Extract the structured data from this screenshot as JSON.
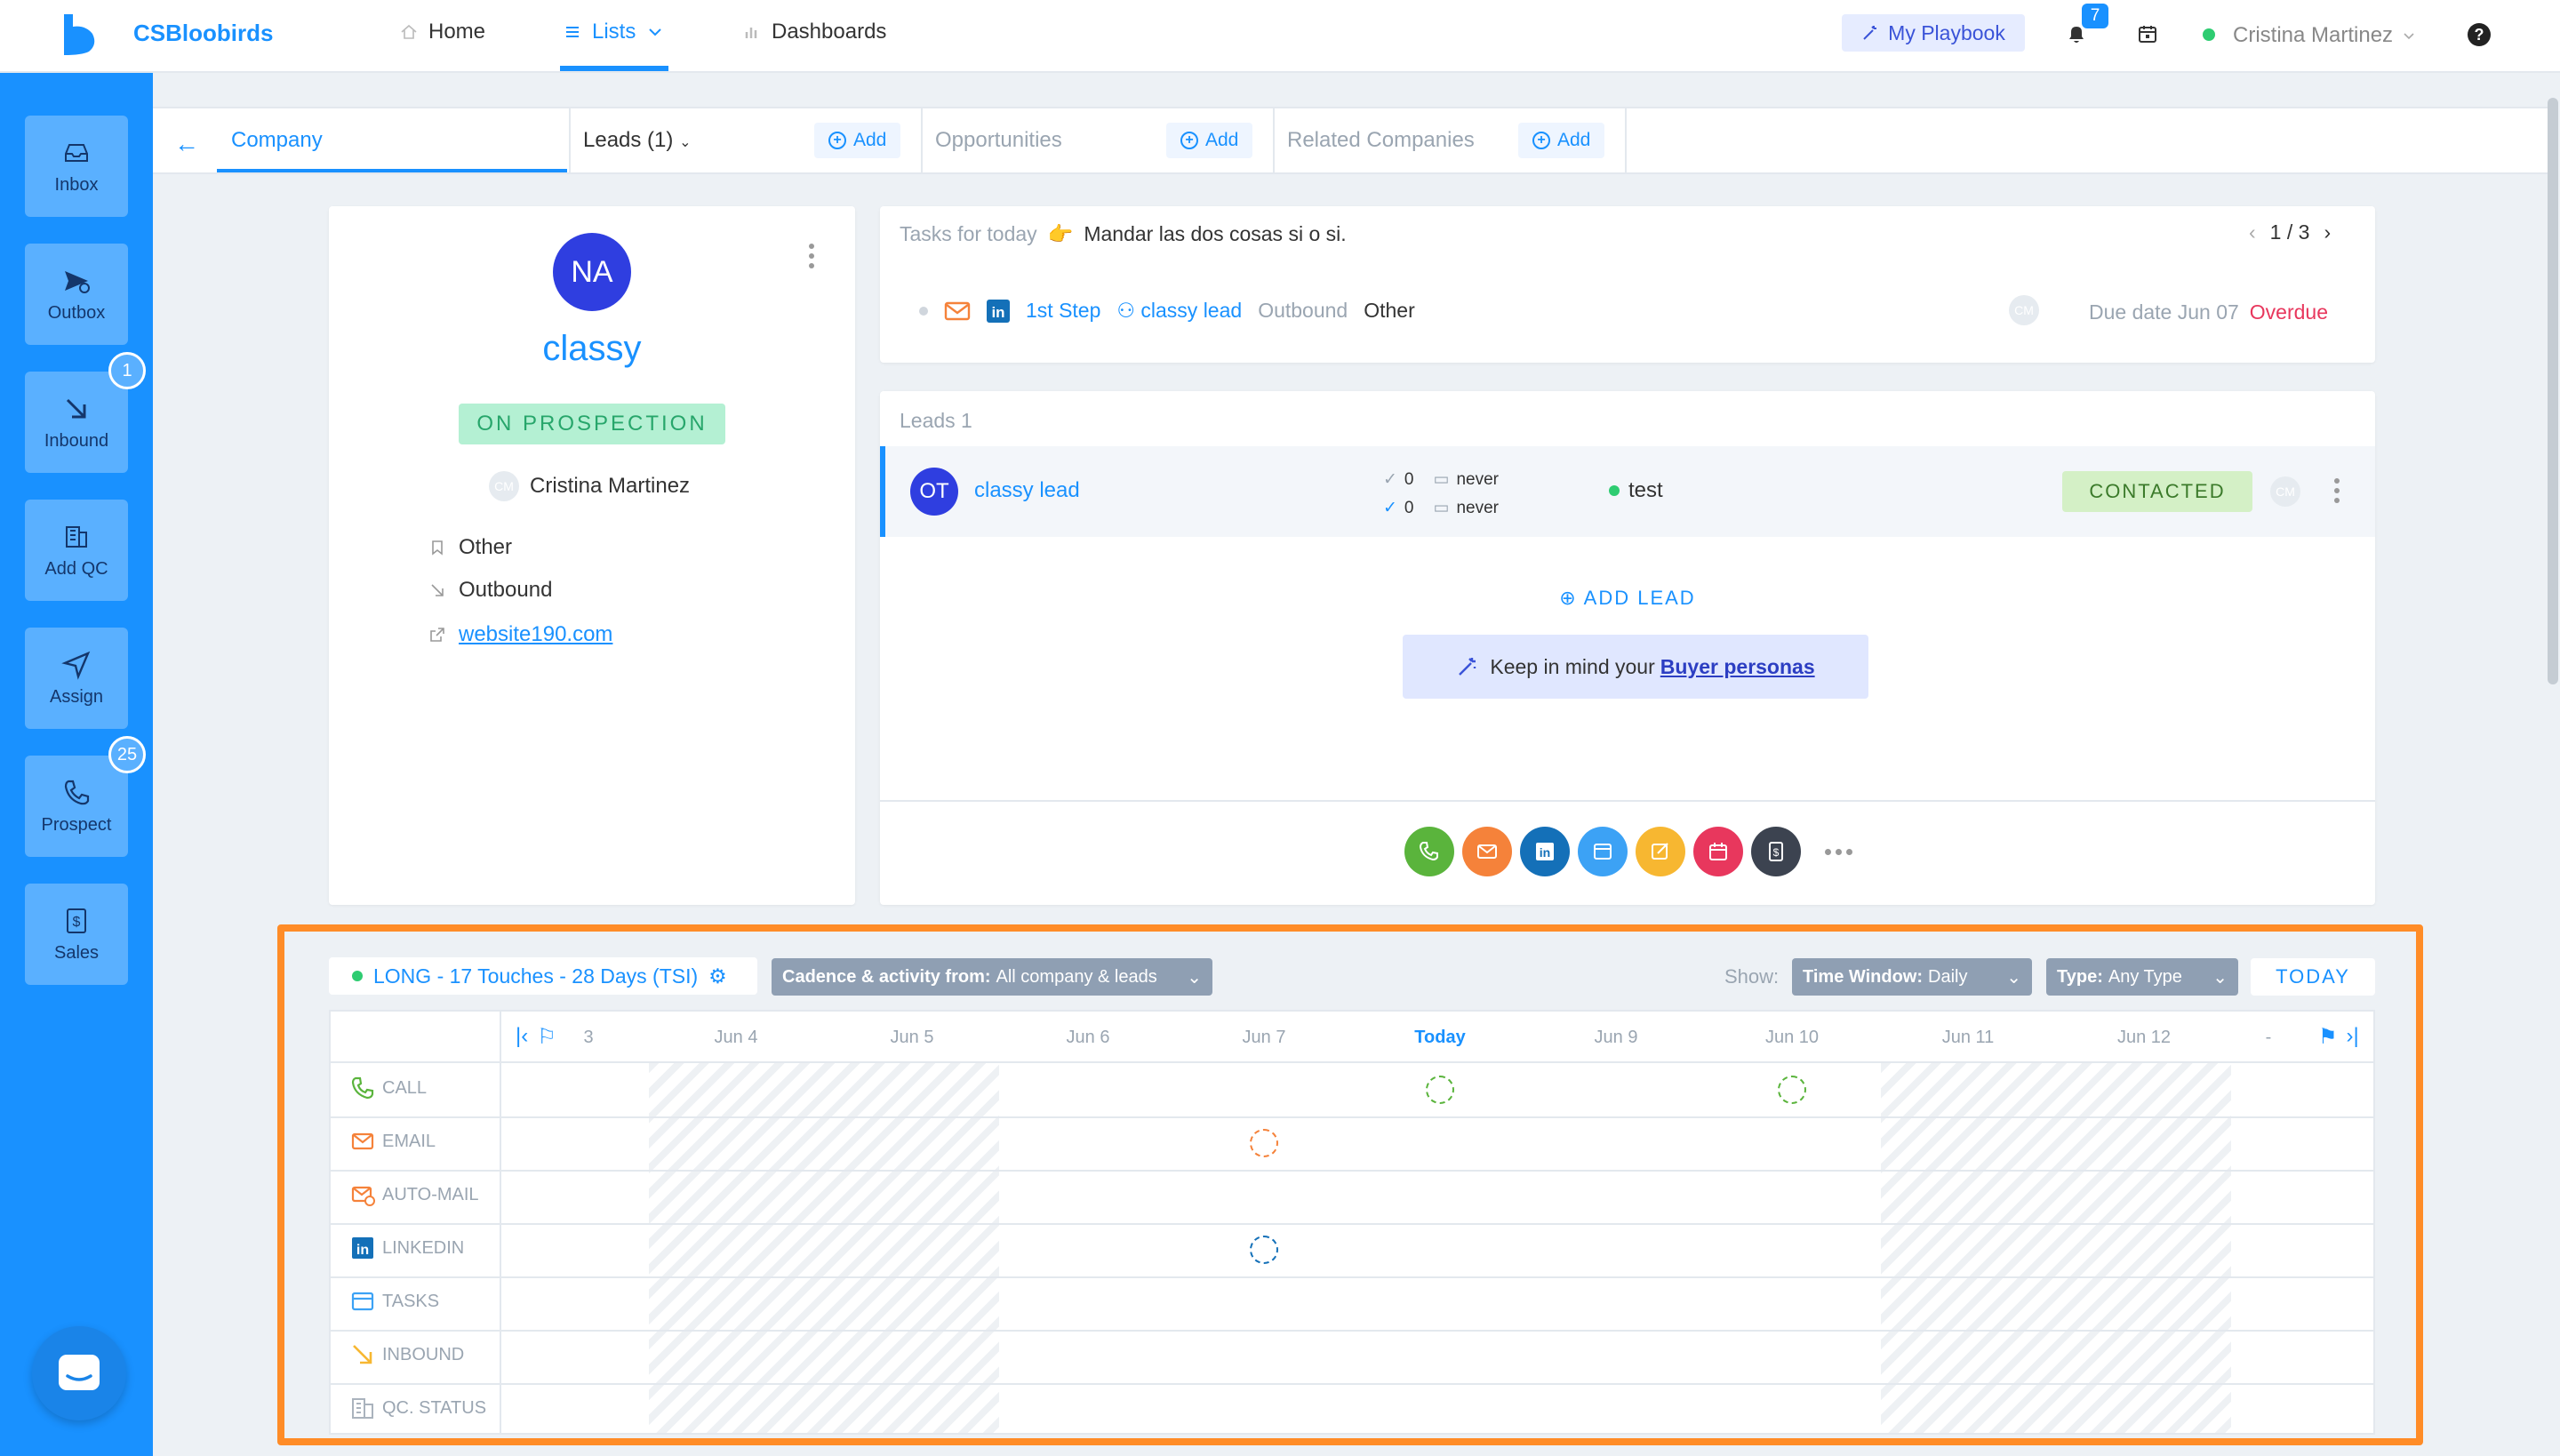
{
  "header": {
    "brand": "CSBloobirds",
    "nav": {
      "home": "Home",
      "lists": "Lists",
      "dashboards": "Dashboards"
    },
    "playbook_label": "My Playbook",
    "notifications_count": "7",
    "user_name": "Cristina Martinez",
    "help": "?"
  },
  "sidebar": {
    "items": [
      {
        "label": "Inbox",
        "icon": "inbox-icon"
      },
      {
        "label": "Outbox",
        "icon": "send-icon"
      },
      {
        "label": "Inbound",
        "icon": "arrow-down-right-icon",
        "badge": "1"
      },
      {
        "label": "Add QC",
        "icon": "building-icon"
      },
      {
        "label": "Assign",
        "icon": "navigation-icon"
      },
      {
        "label": "Prospect",
        "icon": "phone-icon",
        "badge": "25"
      },
      {
        "label": "Sales",
        "icon": "dollar-icon"
      }
    ]
  },
  "tabs": {
    "company": "Company",
    "leads": "Leads (1)",
    "opportunities": "Opportunities",
    "related": "Related Companies",
    "add": "Add"
  },
  "company": {
    "initials": "NA",
    "name": "classy",
    "status": "ON PROSPECTION",
    "owner_initials": "CM",
    "owner": "Cristina Martinez",
    "source": "Other",
    "channel": "Outbound",
    "website": "website190.com"
  },
  "tasks": {
    "title": "Tasks for today",
    "emoji": "👉",
    "description": "Mandar las dos cosas si o si.",
    "pager": "1 / 3",
    "step": "1st Step",
    "lead": "classy lead",
    "type": "Outbound",
    "category": "Other",
    "assignee_initials": "CM",
    "due": "Due date Jun 07",
    "overdue": "Overdue"
  },
  "leads": {
    "title": "Leads 1",
    "lead_initials": "OT",
    "lead_name": "classy lead",
    "stat1_count": "0",
    "stat1_date": "never",
    "stat2_count": "0",
    "stat2_date": "never",
    "lead_status": "test",
    "contact_status": "CONTACTED",
    "assignee_initials": "CM",
    "add_lead": "ADD LEAD",
    "buyer_text": "Keep in mind your",
    "buyer_link": "Buyer personas"
  },
  "cadence": {
    "name": "LONG - 17 Touches - 28 Days (TSI)",
    "filter_label": "Cadence & activity from:",
    "filter_value": "All company & leads",
    "show_label": "Show:",
    "time_window_label": "Time Window:",
    "time_window_value": "Daily",
    "type_label": "Type:",
    "type_value": "Any Type",
    "today_button": "TODAY",
    "days": [
      "3",
      "Jun 4",
      "Jun 5",
      "Jun 6",
      "Jun 7",
      "Today",
      "Jun 9",
      "Jun 10",
      "Jun 11",
      "Jun 12",
      "-"
    ],
    "rows": [
      "CALL",
      "EMAIL",
      "AUTO-MAIL",
      "LINKEDIN",
      "TASKS",
      "INBOUND",
      "QC. STATUS"
    ]
  },
  "colors": {
    "brand": "#1991ff",
    "frame": "#ff8c27",
    "call": "#5ab43c",
    "email": "#f5823a",
    "linkedin": "#1470b8",
    "overdue": "#e8375d"
  }
}
